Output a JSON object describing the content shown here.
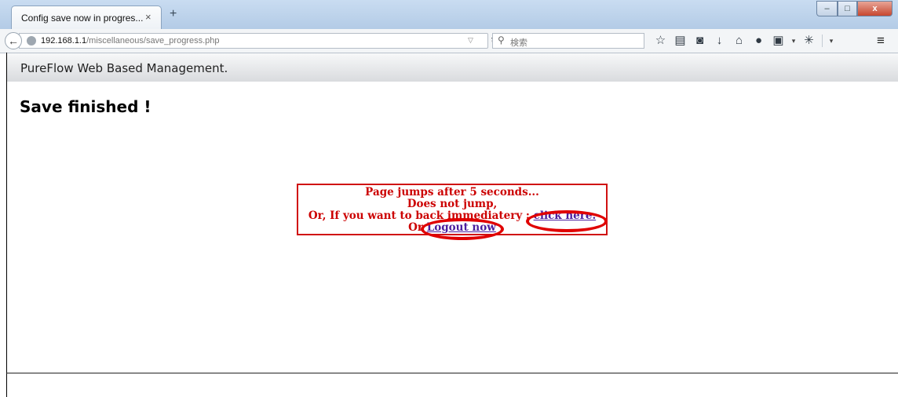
{
  "browser": {
    "tab_title": "Config save now in progres...",
    "tab_close": "×",
    "new_tab": "+",
    "window_buttons": {
      "minimize": "–",
      "maximize": "□",
      "close": "x"
    },
    "url_host": "192.168.1.1",
    "url_path": "/miscellaneous/save_progress.php",
    "search_placeholder": "検索",
    "icons": [
      "back-arrow",
      "site-identity",
      "url-dropdown",
      "reload",
      "search",
      "bookmark-star",
      "reading-list",
      "pocket",
      "download",
      "home",
      "chat",
      "screenshot",
      "extension",
      "menu"
    ]
  },
  "app": {
    "header_title": "PureFlow Web Based Management."
  },
  "main": {
    "heading": "Save finished !",
    "notice": {
      "line1": "Page jumps after 5 seconds...",
      "line2": "Does not jump,",
      "line3_prefix": "Or, If you want to back immediatery : ",
      "line3_link": "click here.",
      "line4_prefix": "Or ",
      "line4_link": "Logout now",
      "border_color": "#d01010",
      "text_color": "#cc0000"
    },
    "annotation_color": "#e00000"
  }
}
